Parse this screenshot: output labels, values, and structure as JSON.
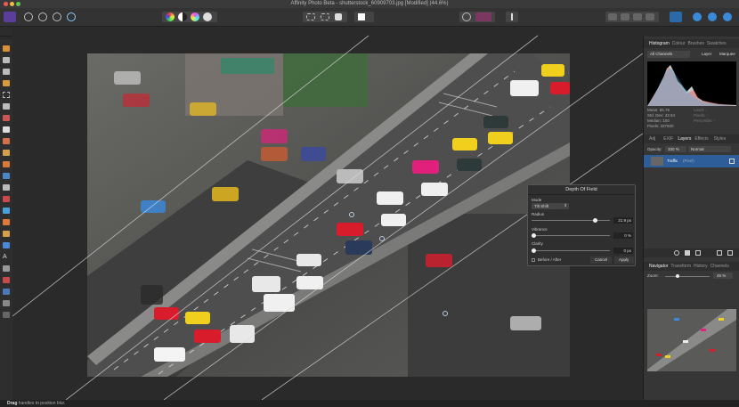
{
  "window": {
    "title": "Affinity Photo Beta - shutterstock_60909703.jpg [Modified] (44.6%)"
  },
  "right_panel": {
    "top_tabs": [
      "Histogram",
      "Colour",
      "Brushes",
      "Swatches"
    ],
    "channels_select": "All Channels",
    "layer_btn": "Layer",
    "marquee_btn": "Marquee",
    "stats": [
      "Mean: 65.76",
      "Std. Dev: 43.94",
      "Median: 100",
      "Pixels: 337600"
    ],
    "stats_right": [
      "Level: -",
      "Pixels: -",
      "Percentile: -"
    ],
    "mid_tabs": [
      "Adj",
      "EXIF",
      "Layers",
      "Effects",
      "Styles"
    ],
    "opacity_label": "Opacity:",
    "opacity_value": "100 %",
    "blend_mode": "Normal",
    "layer_name": "Traffic",
    "layer_kind": "(Pixel)",
    "bottom_tabs": [
      "Navigator",
      "Transform",
      "History",
      "Channels"
    ],
    "zoom_label": "Zoom:",
    "zoom_value": "45 %"
  },
  "dialog": {
    "title": "Depth Of Field",
    "mode_label": "Mode",
    "mode_value": "Tilt Shift",
    "radius_label": "Radius",
    "radius_value": "21.9 px",
    "radius_frac": 0.83,
    "vibrance_label": "Vibrance",
    "vibrance_value": "0 %",
    "vibrance_frac": 0.0,
    "clarity_label": "Clarity",
    "clarity_value": "0 px",
    "clarity_frac": 0.0,
    "before_after": "Before / After",
    "cancel": "Cancel",
    "apply": "Apply"
  },
  "status": {
    "bold": "Drag",
    "text": "handles to position blur."
  }
}
